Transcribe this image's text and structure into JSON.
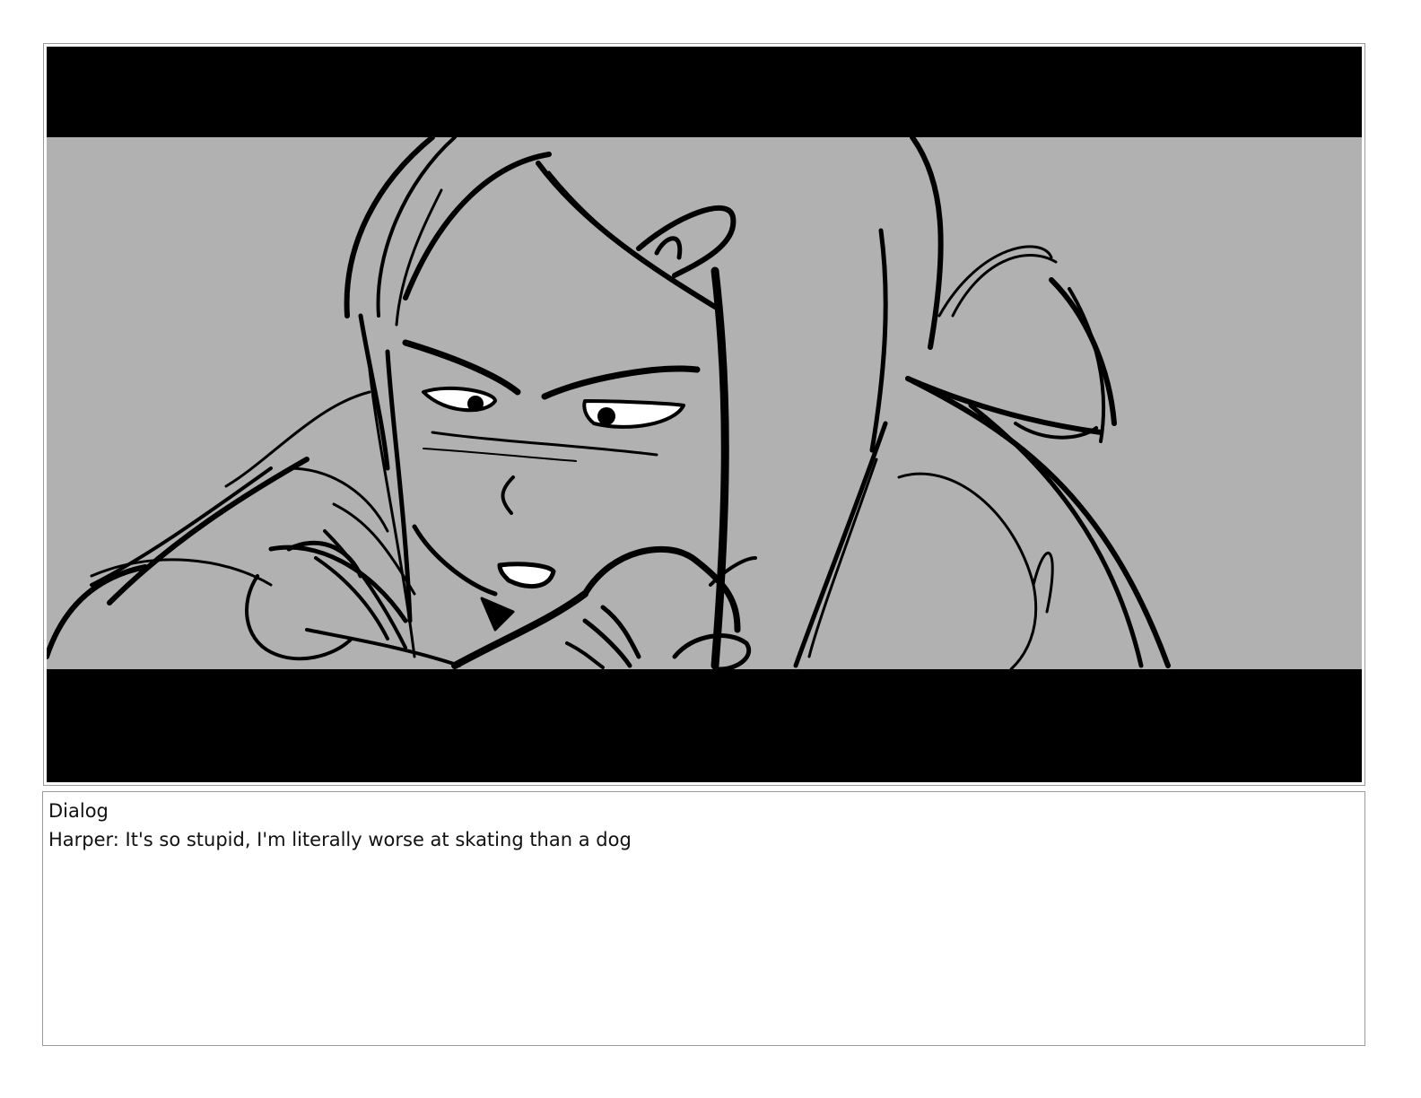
{
  "panel": {
    "letterbox_color": "#000000",
    "background_color": "#b1b1b1",
    "ink_color": "#000000"
  },
  "dialog": {
    "heading": "Dialog",
    "text": "Harper: It's so stupid, I'm literally worse at skating than a dog"
  }
}
